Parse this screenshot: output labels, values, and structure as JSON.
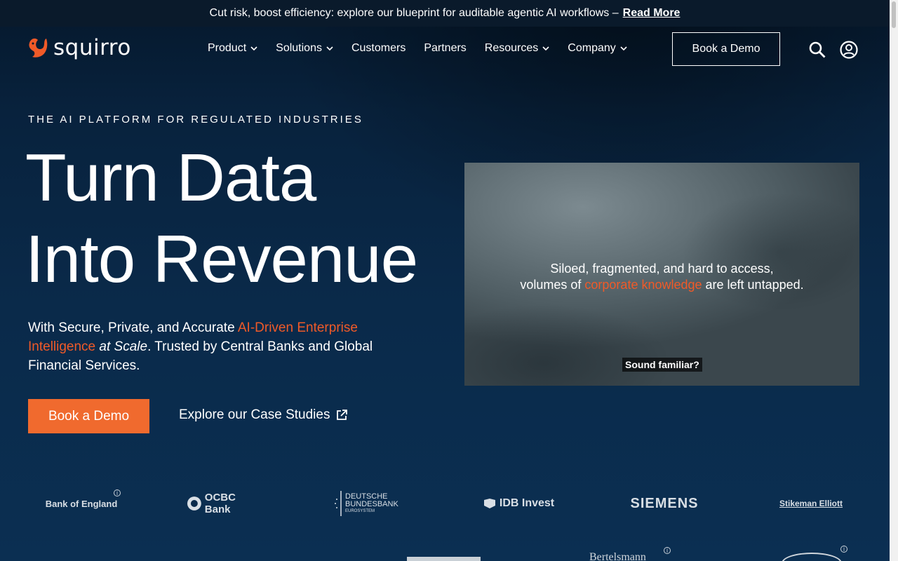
{
  "banner": {
    "text": "Cut risk, boost efficiency: explore our blueprint for auditable agentic AI workflows –",
    "link": "Read More"
  },
  "brand": {
    "name": "squirro",
    "color": "#f05a28"
  },
  "nav": {
    "items": [
      {
        "label": "Product",
        "dropdown": true
      },
      {
        "label": "Solutions",
        "dropdown": true
      },
      {
        "label": "Customers",
        "dropdown": false
      },
      {
        "label": "Partners",
        "dropdown": false
      },
      {
        "label": "Resources",
        "dropdown": true
      },
      {
        "label": "Company",
        "dropdown": true
      }
    ],
    "demo_button": "Book a Demo",
    "icons": [
      "search-icon",
      "user-account-icon"
    ]
  },
  "hero": {
    "eyebrow": "THE AI PLATFORM FOR REGULATED INDUSTRIES",
    "headline_line1": "Turn Data",
    "headline_line2": "Into Revenue",
    "sub_pre": "With Secure, Private, and Accurate ",
    "sub_accent": "AI-Driven Enterprise Intelligence",
    "sub_em": " at Scale",
    "sub_post": ". Trusted by Central Banks and Global Financial Services.",
    "cta_primary": "Book a Demo",
    "cta_secondary": "Explore our Case Studies"
  },
  "video": {
    "line1": "Siloed, fragmented, and hard to access,",
    "line2_pre": "volumes of ",
    "line2_accent": "corporate knowledge",
    "line2_post": " are left untapped.",
    "caption": "Sound familiar?"
  },
  "logos": {
    "row1": [
      {
        "name": "Bank of England"
      },
      {
        "name": "OCBC Bank"
      },
      {
        "name_line1": "DEUTSCHE",
        "name_line2": "BUNDESBANK",
        "name_line3": "EUROSYSTEM"
      },
      {
        "name": "IDB Invest"
      },
      {
        "name": "SIEMENS"
      },
      {
        "name": "Stikeman Elliott"
      }
    ],
    "row2_partial": {
      "bertelsmann": "Bertelsmann"
    }
  },
  "colors": {
    "accent": "#f05a28",
    "background": "#0a2744",
    "cta": "#f06a2e"
  }
}
